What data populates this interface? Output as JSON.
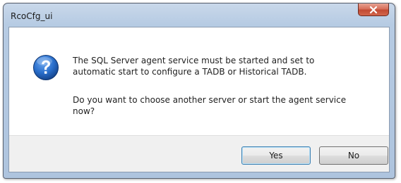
{
  "window": {
    "title": "RcoCfg_ui"
  },
  "dialog": {
    "icon": "question-icon",
    "message_line1": "The SQL Server agent service must be started and set to\nautomatic start to configure a TADB or Historical TADB.",
    "message_line2": "Do you want to choose another server or start the agent service\nnow?"
  },
  "buttons": {
    "yes_label": "Yes",
    "no_label": "No"
  },
  "colors": {
    "title_bar": "#b6cbe3",
    "close_button": "#c24a33",
    "icon_blue": "#1f5fb4",
    "button_bar": "#f0f0f0"
  }
}
